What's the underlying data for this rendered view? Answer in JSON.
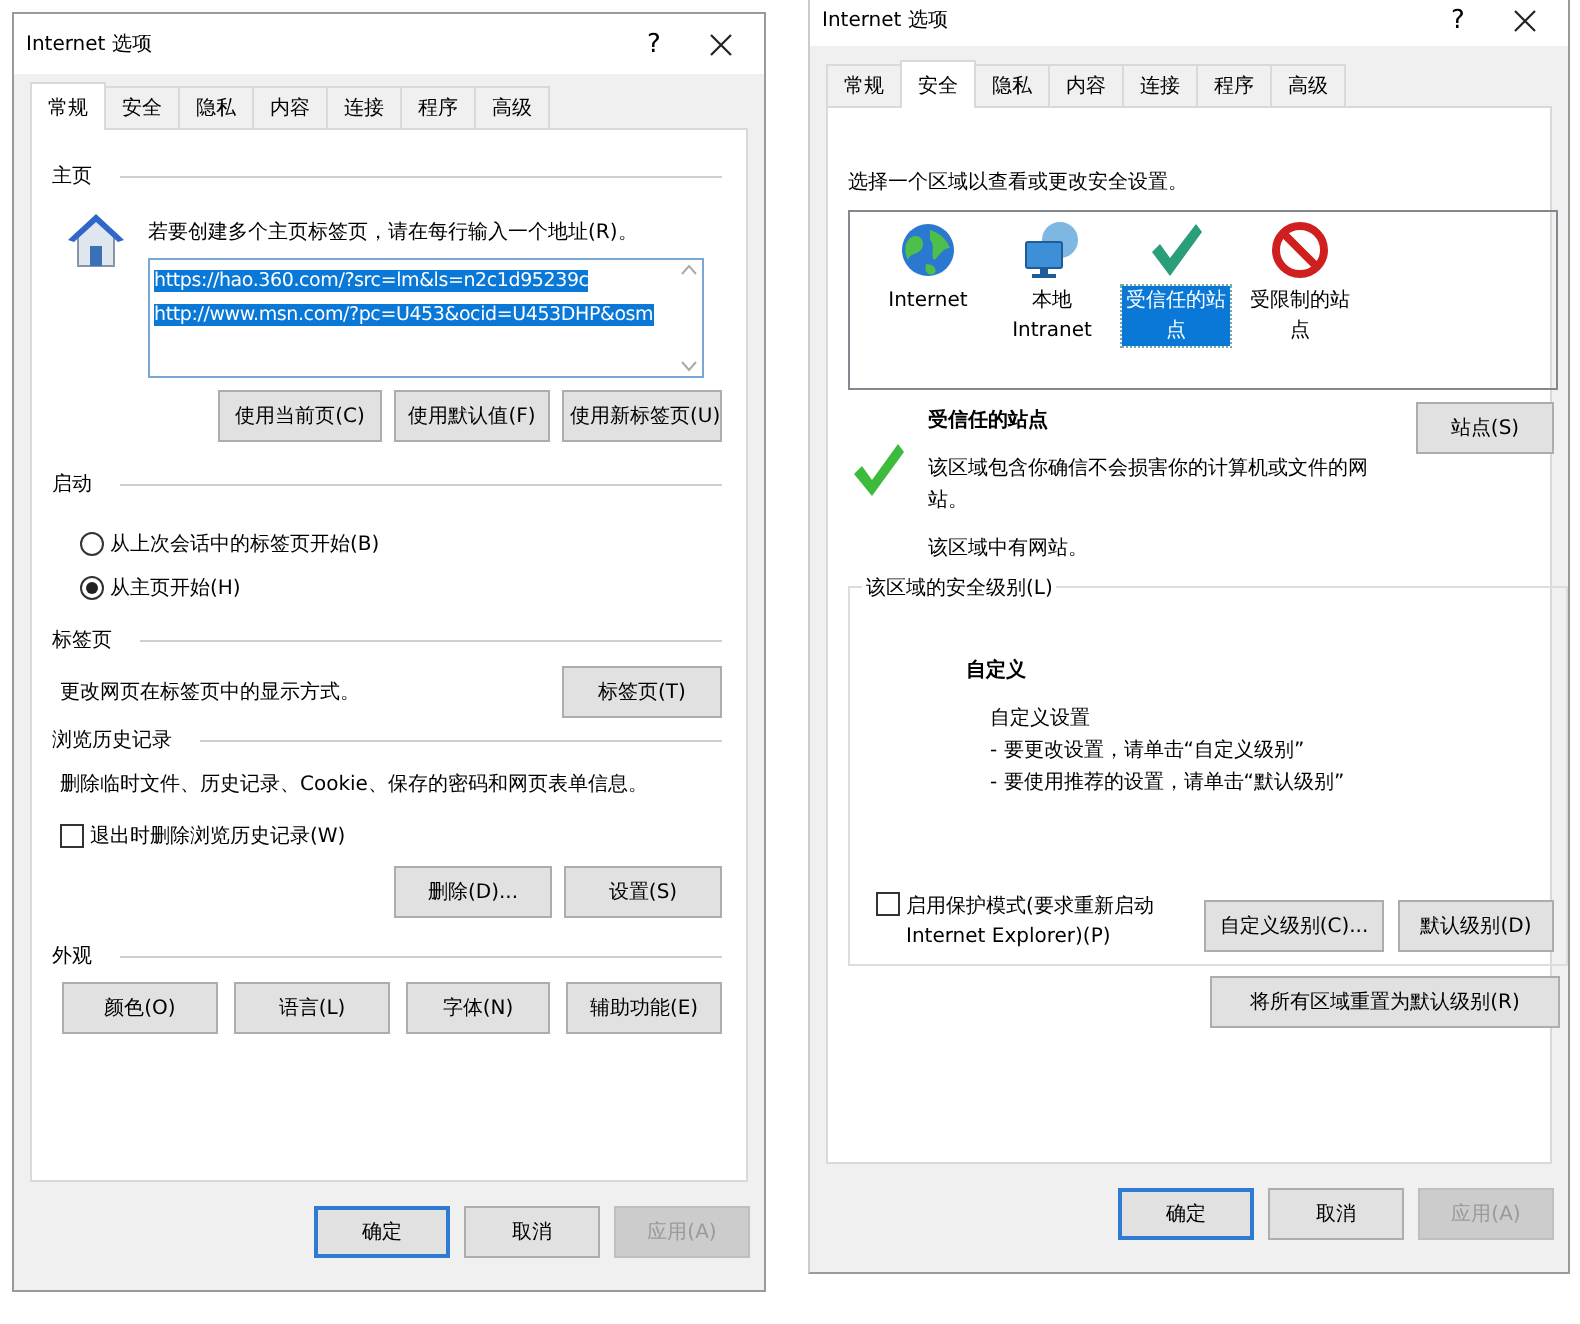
{
  "dialogs": [
    {
      "title": "Internet 选项",
      "help": "?",
      "kind": "general",
      "tabs": [
        {
          "label": "常规",
          "selected": true
        },
        {
          "label": "安全",
          "selected": false
        },
        {
          "label": "隐私",
          "selected": false
        },
        {
          "label": "内容",
          "selected": false
        },
        {
          "label": "连接",
          "selected": false
        },
        {
          "label": "程序",
          "selected": false
        },
        {
          "label": "高级",
          "selected": false
        }
      ],
      "homepage": {
        "heading": "主页",
        "instruction": "若要创建多个主页标签页，请在每行输入一个地址(R)。",
        "urls_selected": true,
        "urls": [
          "https://hao.360.com/?src=lm&ls=n2c1d95239c",
          "http://www.msn.com/?pc=U453&ocid=U453DHP&osm"
        ],
        "buttons": [
          "使用当前页(C)",
          "使用默认值(F)",
          "使用新标签页(U)"
        ]
      },
      "startup": {
        "heading": "启动",
        "options": [
          {
            "label": "从上次会话中的标签页开始(B)",
            "selected": false
          },
          {
            "label": "从主页开始(H)",
            "selected": true
          }
        ]
      },
      "tab_settings": {
        "heading": "标签页",
        "description": "更改网页在标签页中的显示方式。",
        "button": "标签页(T)"
      },
      "history": {
        "heading": "浏览历史记录",
        "description": "删除临时文件、历史记录、Cookie、保存的密码和网页表单信息。",
        "checkbox": {
          "label": "退出时删除浏览历史记录(W)",
          "checked": false
        },
        "buttons": [
          "删除(D)...",
          "设置(S)"
        ]
      },
      "appearance": {
        "heading": "外观",
        "buttons": [
          "颜色(O)",
          "语言(L)",
          "字体(N)",
          "辅助功能(E)"
        ]
      },
      "footer": [
        {
          "label": "确定",
          "default": true,
          "disabled": false
        },
        {
          "label": "取消",
          "default": false,
          "disabled": false
        },
        {
          "label": "应用(A)",
          "default": false,
          "disabled": true
        }
      ]
    },
    {
      "title": "Internet 选项",
      "help": "?",
      "kind": "security",
      "tabs": [
        {
          "label": "常规",
          "selected": false
        },
        {
          "label": "安全",
          "selected": true
        },
        {
          "label": "隐私",
          "selected": false
        },
        {
          "label": "内容",
          "selected": false
        },
        {
          "label": "连接",
          "selected": false
        },
        {
          "label": "程序",
          "selected": false
        },
        {
          "label": "高级",
          "selected": false
        }
      ],
      "prompt": "选择一个区域以查看或更改安全设置。",
      "zones": [
        {
          "label": "Internet",
          "kind": "globe",
          "selected": false
        },
        {
          "label": "本地 Intranet",
          "kind": "network",
          "selected": false
        },
        {
          "label": "受信任的站点",
          "kind": "check",
          "selected": true
        },
        {
          "label": "受限制的站点",
          "kind": "blocked",
          "selected": false
        }
      ],
      "zone_detail": {
        "title": "受信任的站点",
        "description": "该区域包含你确信不会损害你的计算机或文件的网站。",
        "note": "该区域中有网站。",
        "button": "站点(S)"
      },
      "level": {
        "legend": "该区域的安全级别(L)",
        "title": "自定义",
        "lines": [
          "自定义设置",
          "- 要更改设置，请单击“自定义级别”",
          "- 要使用推荐的设置，请单击“默认级别”"
        ],
        "checkbox": {
          "label": "启用保护模式(要求重新启动 Internet Explorer)(P)",
          "checked": false
        },
        "buttons": [
          "自定义级别(C)...",
          "默认级别(D)"
        ],
        "reset_button": "将所有区域重置为默认级别(R)"
      },
      "footer": [
        {
          "label": "确定",
          "default": true,
          "disabled": false
        },
        {
          "label": "取消",
          "default": false,
          "disabled": false
        },
        {
          "label": "应用(A)",
          "default": false,
          "disabled": true
        }
      ]
    }
  ]
}
